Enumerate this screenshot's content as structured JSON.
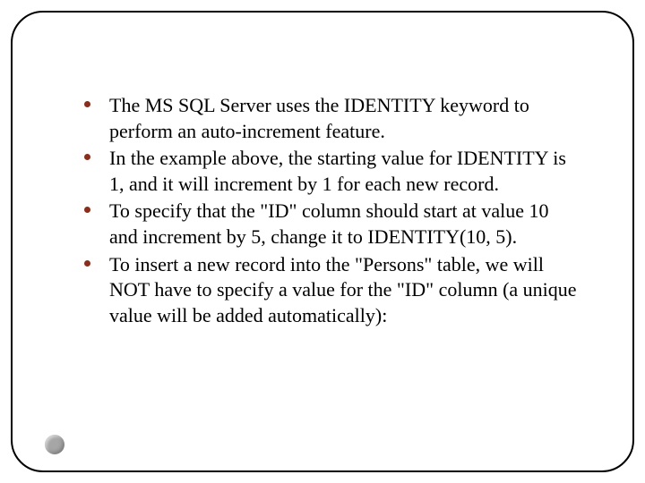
{
  "bullets": [
    "The MS SQL Server uses the IDENTITY keyword to perform an auto-increment feature.",
    "In the example above, the starting value for IDENTITY is 1, and it will increment by 1 for each new record.",
    "To specify that the \"ID\" column should start at value 10 and increment by 5, change it to IDENTITY(10, 5).",
    "To insert a new record into the \"Persons\" table, we will NOT have to specify a value for the \"ID\" column (a unique value will be added automatically):"
  ],
  "bullet_color": "#8c2d19"
}
